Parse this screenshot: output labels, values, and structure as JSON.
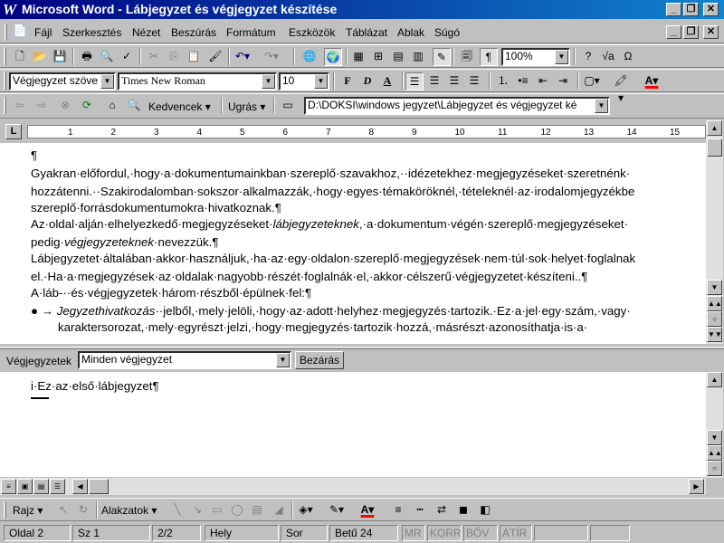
{
  "window": {
    "title": "Microsoft Word - Lábjegyzet és végjegyzet készítése",
    "logo_letter": "W"
  },
  "menu": [
    "Fájl",
    "Szerkesztés",
    "Nézet",
    "Beszúrás",
    "Formátum",
    "Eszközök",
    "Táblázat",
    "Ablak",
    "Súgó"
  ],
  "formatting": {
    "style": "Végjegyzet szöve",
    "font": "Times New Roman",
    "size": "10",
    "bold": "F",
    "italic": "D",
    "underline": "A",
    "zoom": "100%"
  },
  "web_toolbar": {
    "favorites": "Kedvencek",
    "go": "Ugrás",
    "address": "D:\\DOKSI\\windows jegyzet\\Lábjegyzet és végjegyzet ké"
  },
  "ruler_numbers": [
    "1",
    "2",
    "3",
    "4",
    "5",
    "6",
    "7",
    "8",
    "9",
    "10",
    "11",
    "12",
    "13",
    "14",
    "15"
  ],
  "document_lines": [
    "¶",
    "Gyakran·előfordul,·hogy·a·dokumentumainkban·szereplő·szavakhoz,··idézetekhez·megjegyzéseket·szeretnénk·",
    "hozzátenni.··Szakirodalomban·sokszor·alkalmazzák,·hogy·egyes·témaköröknél,·tételeknél·az·irodalomjegyzékbe",
    "szereplő·forrásdokumentumokra·hivatkoznak.¶",
    "Az·oldal·alján·elhelyezkedő·megjegyzéseket·lábjegyzeteknek,·a·dokumentum·végén·szereplő·megjegyzéseket·",
    "pedig·végjegyzeteknek·nevezzük.¶",
    "Lábjegyzetet·általában·akkor·használjuk,·ha·az·egy·oldalon·szereplő·megjegyzések·nem·túl·sok·helyet·foglalnak",
    "el.·Ha·a·megjegyzések·az·oldalak·nagyobb·részét·foglalnák·el,·akkor·célszerű·végjegyzetet·készíteni..¶",
    "A·láb-··és·végjegyzetek·három·részből·épülnek·fel:¶",
    "●  →  Jegyzethivatkozás··jelből,·mely·jelöli,·hogy·az·adott·helyhez·megjegyzés·tartozik.·Ez·a·jel·egy·szám,·vagy·",
    "karaktersorozat,·mely·egyrészt·jelzi,·hogy·megjegyzés·tartozik·hozzá,·másrészt·azonosíthatja·is·a·"
  ],
  "notes_pane": {
    "label": "Végjegyzetek",
    "filter": "Minden végjegyzet",
    "close": "Bezárás",
    "text": "i·Ez·az·első·lábjegyzet¶"
  },
  "drawing": {
    "draw": "Rajz",
    "shapes": "Alakzatok"
  },
  "status": {
    "page": "Oldal 2",
    "section": "Sz 1",
    "pages": "2/2",
    "at": "Hely",
    "line": "Sor",
    "col": "Betű 24",
    "rec": "MR",
    "trk": "KORR",
    "ext": "BŐV",
    "ovr": "ÁTÍR"
  }
}
